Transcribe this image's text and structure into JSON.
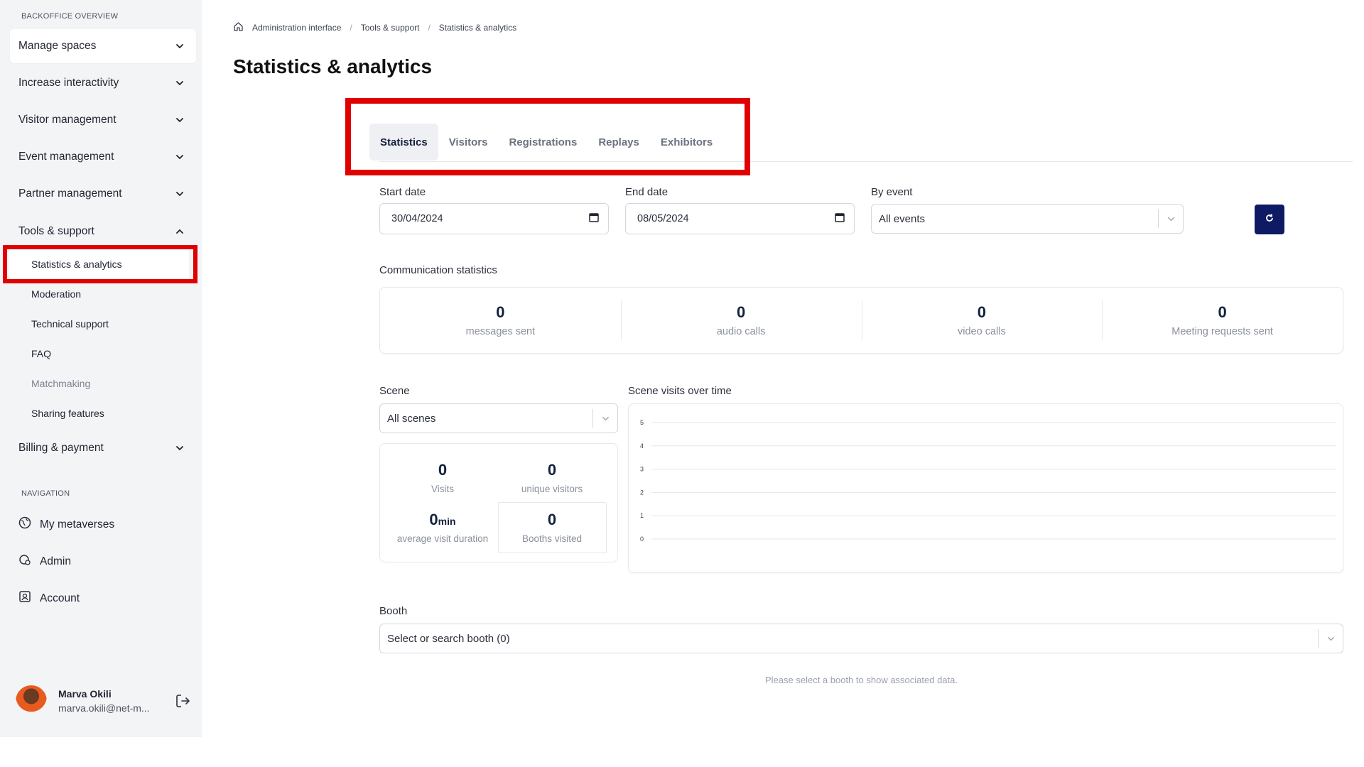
{
  "sidebar": {
    "overview_label": "BACKOFFICE OVERVIEW",
    "items": [
      {
        "label": "Manage spaces"
      },
      {
        "label": "Increase interactivity"
      },
      {
        "label": "Visitor management"
      },
      {
        "label": "Event management"
      },
      {
        "label": "Partner management"
      },
      {
        "label": "Tools & support"
      },
      {
        "label": "Billing & payment"
      }
    ],
    "tools_sub": [
      {
        "label": "Statistics & analytics"
      },
      {
        "label": "Moderation"
      },
      {
        "label": "Technical support"
      },
      {
        "label": "FAQ"
      },
      {
        "label": "Matchmaking"
      },
      {
        "label": "Sharing features"
      }
    ],
    "navigation_label": "NAVIGATION",
    "nav": [
      {
        "label": "My metaverses",
        "icon": "globe-icon"
      },
      {
        "label": "Admin",
        "icon": "admin-icon"
      },
      {
        "label": "Account",
        "icon": "account-icon"
      }
    ],
    "user": {
      "name": "Marva Okili",
      "email": "marva.okili@net-m..."
    }
  },
  "breadcrumb": [
    "Administration interface",
    "Tools & support",
    "Statistics & analytics"
  ],
  "page_title": "Statistics & analytics",
  "tabs": [
    "Statistics",
    "Visitors",
    "Registrations",
    "Replays",
    "Exhibitors"
  ],
  "filters": {
    "start_date_label": "Start date",
    "start_date_value": "30/04/2024",
    "end_date_label": "End date",
    "end_date_value": "08/05/2024",
    "event_label": "By event",
    "event_value": "All events"
  },
  "communication": {
    "title": "Communication statistics",
    "stats": [
      {
        "value": "0",
        "label": "messages sent"
      },
      {
        "value": "0",
        "label": "audio calls"
      },
      {
        "value": "0",
        "label": "video calls"
      },
      {
        "value": "0",
        "label": "Meeting requests sent"
      }
    ]
  },
  "scene": {
    "label": "Scene",
    "select_value": "All scenes",
    "visits": {
      "value": "0",
      "label": "Visits"
    },
    "unique": {
      "value": "0",
      "label": "unique visitors"
    },
    "duration": {
      "value": "0",
      "unit": "min",
      "label": "average visit duration"
    },
    "booths": {
      "value": "0",
      "label": "Booths visited"
    }
  },
  "chart_title": "Scene visits over time",
  "chart_data": {
    "type": "line",
    "title": "Scene visits over time",
    "xlabel": "",
    "ylabel": "",
    "y_ticks": [
      "0",
      "1",
      "2",
      "3",
      "4",
      "5"
    ],
    "ylim": [
      0,
      5
    ],
    "series": [],
    "grid": true
  },
  "booth": {
    "label": "Booth",
    "placeholder": "Select or search booth (0)",
    "hint": "Please select a booth to show associated data."
  },
  "colors": {
    "accent": "#0e1a63",
    "highlight": "#e00000"
  }
}
